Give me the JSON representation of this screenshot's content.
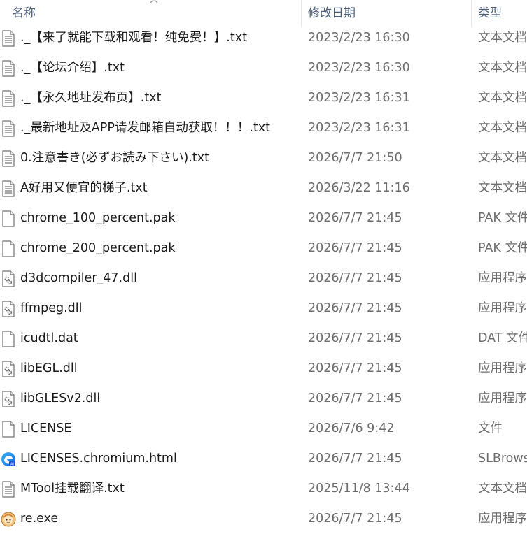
{
  "columns": {
    "name": "名称",
    "date": "修改日期",
    "type": "类型"
  },
  "files": [
    {
      "name": "._【来了就能下载和观看！纯免费！】.txt",
      "date": "2023/2/23 16:30",
      "type": "文本文档",
      "icon": "text-file-icon"
    },
    {
      "name": "._【论坛介绍】.txt",
      "date": "2023/2/23 16:30",
      "type": "文本文档",
      "icon": "text-file-icon"
    },
    {
      "name": "._【永久地址发布页】.txt",
      "date": "2023/2/23 16:31",
      "type": "文本文档",
      "icon": "text-file-icon"
    },
    {
      "name": "._最新地址及APP请发邮箱自动获取！！！.txt",
      "date": "2023/2/23 16:31",
      "type": "文本文档",
      "icon": "text-file-icon"
    },
    {
      "name": "0.注意書き(必ずお読み下さい).txt",
      "date": "2026/7/7 21:50",
      "type": "文本文档",
      "icon": "text-file-icon"
    },
    {
      "name": "A好用又便宜的梯子.txt",
      "date": "2026/3/22 11:16",
      "type": "文本文档",
      "icon": "text-file-icon"
    },
    {
      "name": "chrome_100_percent.pak",
      "date": "2026/7/7 21:45",
      "type": "PAK 文件",
      "icon": "blank-file-icon"
    },
    {
      "name": "chrome_200_percent.pak",
      "date": "2026/7/7 21:45",
      "type": "PAK 文件",
      "icon": "blank-file-icon"
    },
    {
      "name": "d3dcompiler_47.dll",
      "date": "2026/7/7 21:45",
      "type": "应用程序扩展",
      "icon": "dll-file-icon"
    },
    {
      "name": "ffmpeg.dll",
      "date": "2026/7/7 21:45",
      "type": "应用程序扩展",
      "icon": "dll-file-icon"
    },
    {
      "name": "icudtl.dat",
      "date": "2026/7/7 21:45",
      "type": "DAT 文件",
      "icon": "blank-file-icon"
    },
    {
      "name": "libEGL.dll",
      "date": "2026/7/7 21:45",
      "type": "应用程序扩展",
      "icon": "dll-file-icon"
    },
    {
      "name": "libGLESv2.dll",
      "date": "2026/7/7 21:45",
      "type": "应用程序扩展",
      "icon": "dll-file-icon"
    },
    {
      "name": "LICENSE",
      "date": "2026/7/6 9:42",
      "type": "文件",
      "icon": "blank-file-icon"
    },
    {
      "name": "LICENSES.chromium.html",
      "date": "2026/7/7 21:45",
      "type": "SLBrowser",
      "icon": "browser-file-icon"
    },
    {
      "name": "MTool挂载翻译.txt",
      "date": "2025/11/8 13:44",
      "type": "文本文档",
      "icon": "text-file-icon"
    },
    {
      "name": "re.exe",
      "date": "2026/7/7 21:45",
      "type": "应用程序",
      "icon": "exe-app-icon"
    }
  ]
}
